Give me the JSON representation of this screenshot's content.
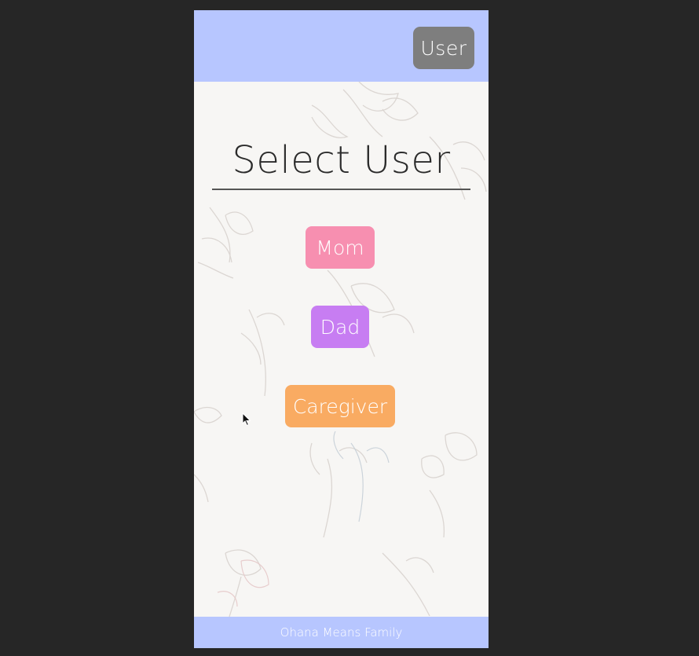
{
  "header": {
    "user_button_label": "User"
  },
  "main": {
    "title": "Select User",
    "roles": [
      {
        "label": "Mom",
        "color": "#f78fb0"
      },
      {
        "label": "Dad",
        "color": "#c77df2"
      },
      {
        "label": "Caregiver",
        "color": "#f9ab62"
      }
    ]
  },
  "footer": {
    "text": "Ohana Means Family"
  },
  "theme": {
    "bar_color": "#b7c6ff",
    "page_background": "#f7f6f4",
    "outer_background": "#262626",
    "user_button_color": "#7e7e7e"
  },
  "icons": {
    "cursor": "mouse-pointer-icon"
  }
}
